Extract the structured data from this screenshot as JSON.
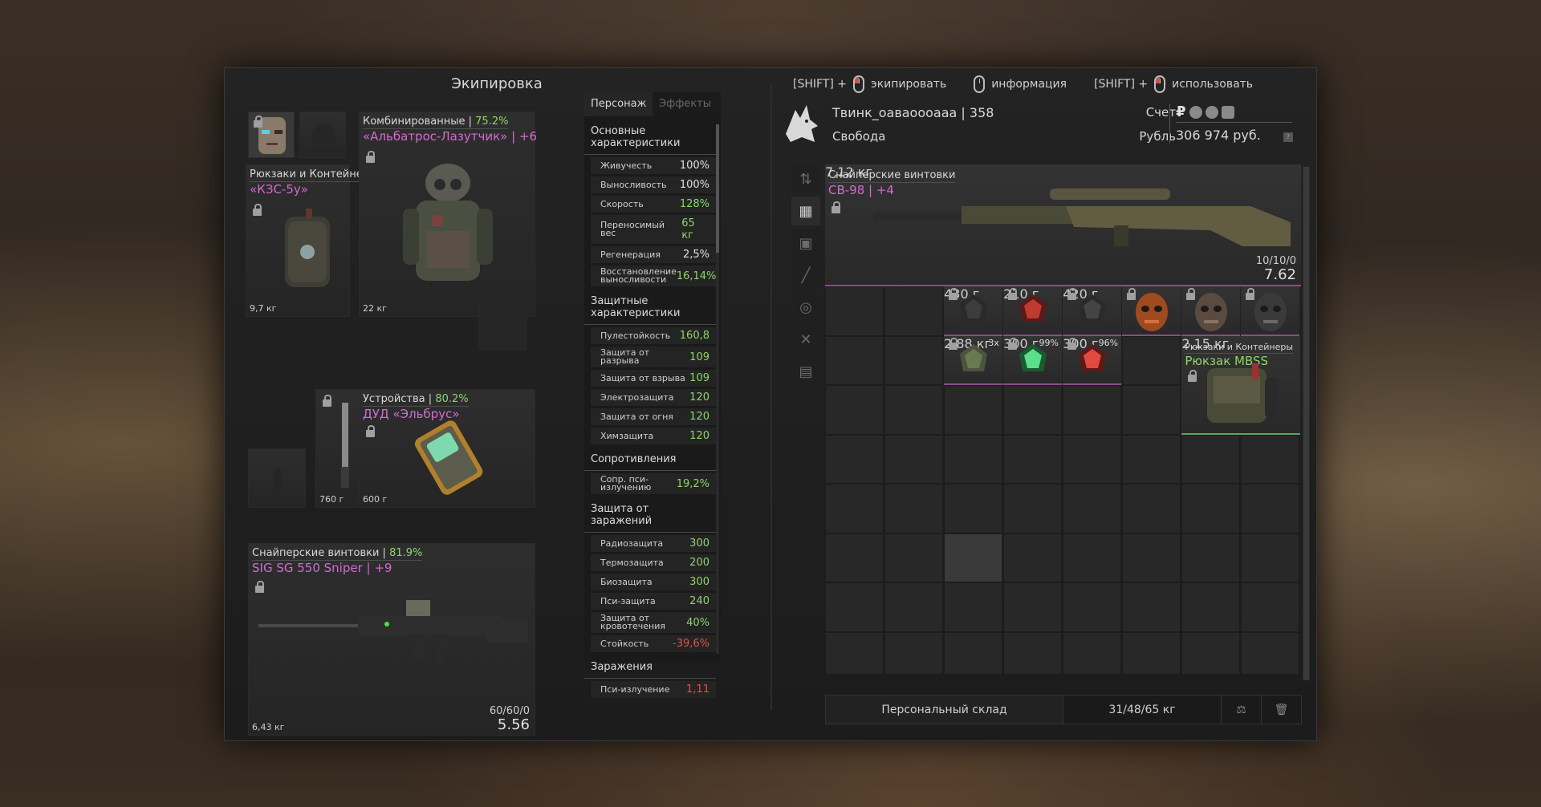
{
  "title": "Экипировка",
  "hints": [
    {
      "prefix": "[SHIFT] +",
      "label": "экипировать"
    },
    {
      "prefix": "",
      "label": "информация"
    },
    {
      "prefix": "[SHIFT] +",
      "label": "использовать"
    }
  ],
  "equipment": {
    "backpack": {
      "category": "Рюкзаки и Контейнеры",
      "name": "«КЗС-5у»",
      "weight": "9,7 кг"
    },
    "armor": {
      "category": "Комбинированные",
      "pct": "75.2%",
      "name": "«Альбатрос-Лазутчик» | +6",
      "weight": "22 кг"
    },
    "melee": {
      "weight": "760 г"
    },
    "device": {
      "category": "Устройства",
      "pct": "80.2%",
      "name": "ДУД «Эльбрус»",
      "weight": "600 г"
    },
    "weapon": {
      "category": "Снайперские винтовки",
      "pct": "81.9%",
      "name": "SIG SG 550 Sniper | +9",
      "weight": "6,43 кг",
      "ammo": "60/60/0",
      "caliber": "5.56"
    }
  },
  "stats": {
    "tabs": [
      "Персонаж",
      "Эффекты"
    ],
    "basic_title": "Основные характеристики",
    "basic": [
      {
        "label": "Живучесть",
        "value": "100%",
        "tone": "w"
      },
      {
        "label": "Выносливость",
        "value": "100%",
        "tone": "w"
      },
      {
        "label": "Скорость",
        "value": "128%",
        "tone": "g"
      },
      {
        "label": "Переносимый вес",
        "value": "65 кг",
        "tone": "g"
      },
      {
        "label": "Регенерация",
        "value": "2,5%",
        "tone": "w"
      },
      {
        "label": "Восстановление выносливости",
        "value": "16,14%",
        "tone": "g"
      }
    ],
    "protect_title": "Защитные характеристики",
    "protect": [
      {
        "label": "Пулестойкость",
        "value": "160,8",
        "tone": "g"
      },
      {
        "label": "Защита от разрыва",
        "value": "109",
        "tone": "g"
      },
      {
        "label": "Защита от взрыва",
        "value": "109",
        "tone": "g"
      },
      {
        "label": "Электрозащита",
        "value": "120",
        "tone": "g"
      },
      {
        "label": "Защита от огня",
        "value": "120",
        "tone": "g"
      },
      {
        "label": "Химзащита",
        "value": "120",
        "tone": "g"
      }
    ],
    "resist_title": "Сопротивления",
    "resist": [
      {
        "label": "Сопр. пси-излучению",
        "value": "19,2%",
        "tone": "g"
      }
    ],
    "infect_title": "Защита от заражений",
    "infect": [
      {
        "label": "Радиозащита",
        "value": "300",
        "tone": "g"
      },
      {
        "label": "Термозащита",
        "value": "200",
        "tone": "g"
      },
      {
        "label": "Биозащита",
        "value": "300",
        "tone": "g"
      },
      {
        "label": "Пси-защита",
        "value": "240",
        "tone": "g"
      },
      {
        "label": "Защита от кровотечения",
        "value": "40%",
        "tone": "g"
      },
      {
        "label": "Стойкость",
        "value": "-39,6%",
        "tone": "r"
      }
    ],
    "contam_title": "Заражения",
    "contam": [
      {
        "label": "Пси-излучение",
        "value": "1,11",
        "tone": "r"
      }
    ]
  },
  "player": {
    "name": "Твинк_оаваоооааа | 358",
    "faction": "Свобода",
    "account_label": "Счет",
    "currency_label": "Рубль",
    "money": "306 974 руб.",
    "help": "?"
  },
  "inventory": {
    "rifle": {
      "category": "Снайперские винтовки",
      "name": "СВ-98 | +4",
      "weight": "7,12 кг",
      "ammo": "10/10/0",
      "caliber": "7.62"
    },
    "items": [
      {
        "weight": "430 г"
      },
      {
        "weight": "210 г"
      },
      {
        "weight": "420 г"
      },
      {
        "weight": "2,88 кг",
        "count": "3x"
      },
      {
        "weight": "300 г",
        "count": "99%"
      },
      {
        "weight": "300 г",
        "count": "96%"
      }
    ],
    "backpack": {
      "category": "Рюкзаки и Контейнеры",
      "name": "Рюкзак MBSS",
      "weight": "2,15 кг"
    }
  },
  "footer": {
    "tab": "Персональный склад",
    "weight": "31/48/65 кг"
  },
  "colors": {
    "accent_purple": "#d46ad0",
    "accent_green": "#8fd56a",
    "negative": "#e0534a"
  }
}
